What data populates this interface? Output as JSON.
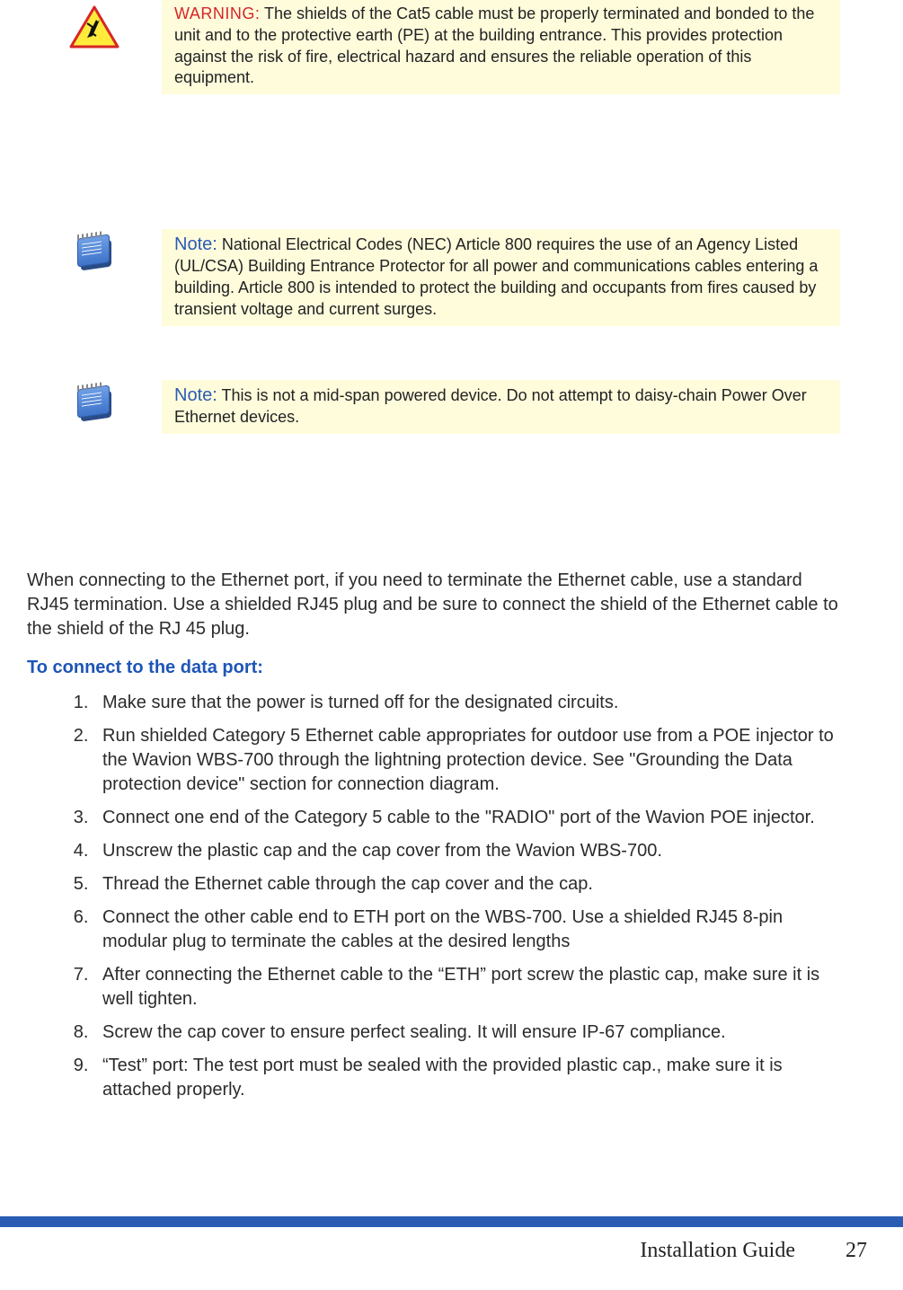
{
  "callouts": {
    "warning": {
      "label": "WARNING:",
      "text": "The shields of the Cat5 cable must be properly terminated and bonded to the unit and to the protective earth (PE) at the building entrance. This provides protection against the risk of fire, electrical hazard and ensures the reliable operation of this equipment."
    },
    "note1": {
      "label": "Note:",
      "text": "National Electrical Codes (NEC) Article 800 requires the use of an Agency Listed (UL/CSA) Building Entrance Protector for all power and communications cables entering a building. Article 800 is intended to protect the building and occupants from fires caused by transient voltage and current surges."
    },
    "note2": {
      "label": "Note:",
      "text": "This is not a mid-span powered device. Do not attempt to daisy-chain Power Over Ethernet devices."
    }
  },
  "body": {
    "intro": "When connecting to the Ethernet port, if you need to terminate the Ethernet cable, use a standard RJ45 termination. Use a shielded RJ45 plug and be sure to connect the shield of the Ethernet cable to the shield of the RJ 45 plug.",
    "heading": "To connect to the data port:",
    "steps": [
      "Make sure that the power is turned off for the designated circuits.",
      "Run shielded Category 5 Ethernet cable appropriates for outdoor use from a POE injector to the Wavion WBS-700 through the lightning protection device. See \"Grounding the Data protection device\" section for connection diagram.",
      "Connect one end of the Category 5 cable to the \"RADIO\" port of the Wavion POE injector.",
      "Unscrew the plastic cap and the cap cover from the Wavion WBS-700.",
      "Thread the Ethernet cable through the cap cover and the cap.",
      "Connect the other cable end to ETH port on the WBS-700. Use a shielded RJ45 8-pin modular plug to terminate the cables at the desired lengths",
      "After connecting the Ethernet cable to the “ETH” port screw the plastic cap, make sure it is well tighten.",
      " Screw the cap cover to ensure perfect sealing. It will ensure IP-67 compliance.",
      "“Test” port: The test port must be sealed with the provided plastic cap., make sure it is attached properly."
    ]
  },
  "footer": {
    "title": "Installation Guide",
    "page": "27"
  }
}
